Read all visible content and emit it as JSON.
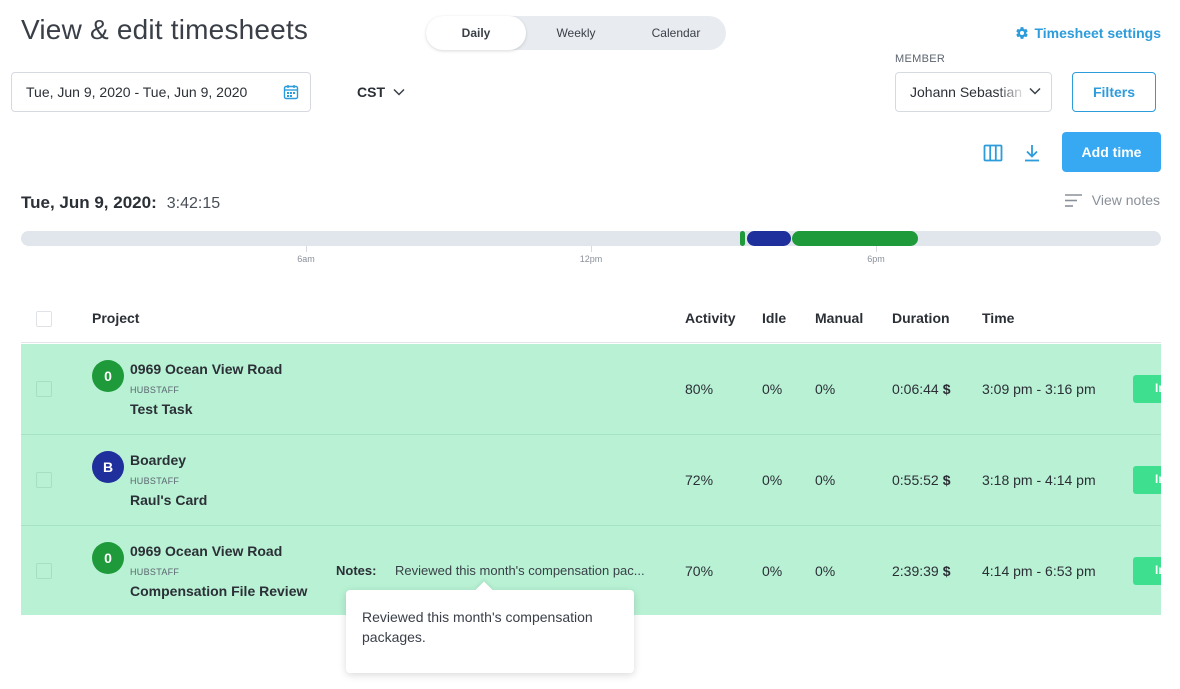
{
  "page": {
    "title": "View & edit timesheets"
  },
  "view_tabs": [
    {
      "label": "Daily",
      "active": true
    },
    {
      "label": "Weekly",
      "active": false
    },
    {
      "label": "Calendar",
      "active": false
    }
  ],
  "settings_link": {
    "label": "Timesheet settings",
    "icon": "gear-icon"
  },
  "date_range": {
    "value": "Tue, Jun 9, 2020 - Tue, Jun 9, 2020",
    "icon": "calendar-icon"
  },
  "timezone": {
    "value": "CST"
  },
  "member": {
    "label": "MEMBER",
    "value": "Johann Sebastian"
  },
  "filters_button": {
    "label": "Filters"
  },
  "toolbar": {
    "columns_icon": "columns-icon",
    "download_icon": "download-icon",
    "add_time_label": "Add time"
  },
  "day": {
    "date": "Tue, Jun 9, 2020:",
    "total": "3:42:15"
  },
  "view_notes": {
    "label": "View notes",
    "icon": "notes-icon"
  },
  "timeline": {
    "ticks": [
      "6am",
      "12pm",
      "6pm"
    ],
    "segments": [
      {
        "start": "3:09 pm",
        "end": "3:16 pm",
        "color": "#1e9a3a"
      },
      {
        "start": "3:18 pm",
        "end": "4:14 pm",
        "color": "#1f2f9b"
      },
      {
        "start": "4:14 pm",
        "end": "6:53 pm",
        "color": "#1e9a3a"
      }
    ]
  },
  "table": {
    "columns": [
      "Project",
      "Activity",
      "Idle",
      "Manual",
      "Duration",
      "Time"
    ],
    "rows": [
      {
        "avatar": "0",
        "avatar_color": "#1e9a3a",
        "project": "0969 Ocean View Road",
        "org": "HUBSTAFF",
        "task": "Test Task",
        "notes_label": "",
        "notes": "",
        "activity": "80%",
        "idle": "0%",
        "manual": "0%",
        "duration": "0:06:44",
        "currency": "$",
        "time": "3:09 pm - 3:16 pm",
        "status": "In"
      },
      {
        "avatar": "B",
        "avatar_color": "#1f2f9b",
        "project": "Boardey",
        "org": "HUBSTAFF",
        "task": "Raul's Card",
        "notes_label": "",
        "notes": "",
        "activity": "72%",
        "idle": "0%",
        "manual": "0%",
        "duration": "0:55:52",
        "currency": "$",
        "time": "3:18 pm - 4:14 pm",
        "status": "In"
      },
      {
        "avatar": "0",
        "avatar_color": "#1e9a3a",
        "project": "0969 Ocean View Road",
        "org": "HUBSTAFF",
        "task": "Compensation File Review",
        "notes_label": "Notes:",
        "notes": "Reviewed this month's compensation pac...",
        "activity": "70%",
        "idle": "0%",
        "manual": "0%",
        "duration": "2:39:39",
        "currency": "$",
        "time": "4:14 pm - 6:53 pm",
        "status": "In"
      }
    ]
  },
  "tooltip": {
    "text": "Reviewed this month's compensation packages."
  },
  "colors": {
    "accent": "#36a9f2",
    "link": "#2d9cdb",
    "row_bg": "#b8f1d4",
    "status": "#3ee08f"
  }
}
